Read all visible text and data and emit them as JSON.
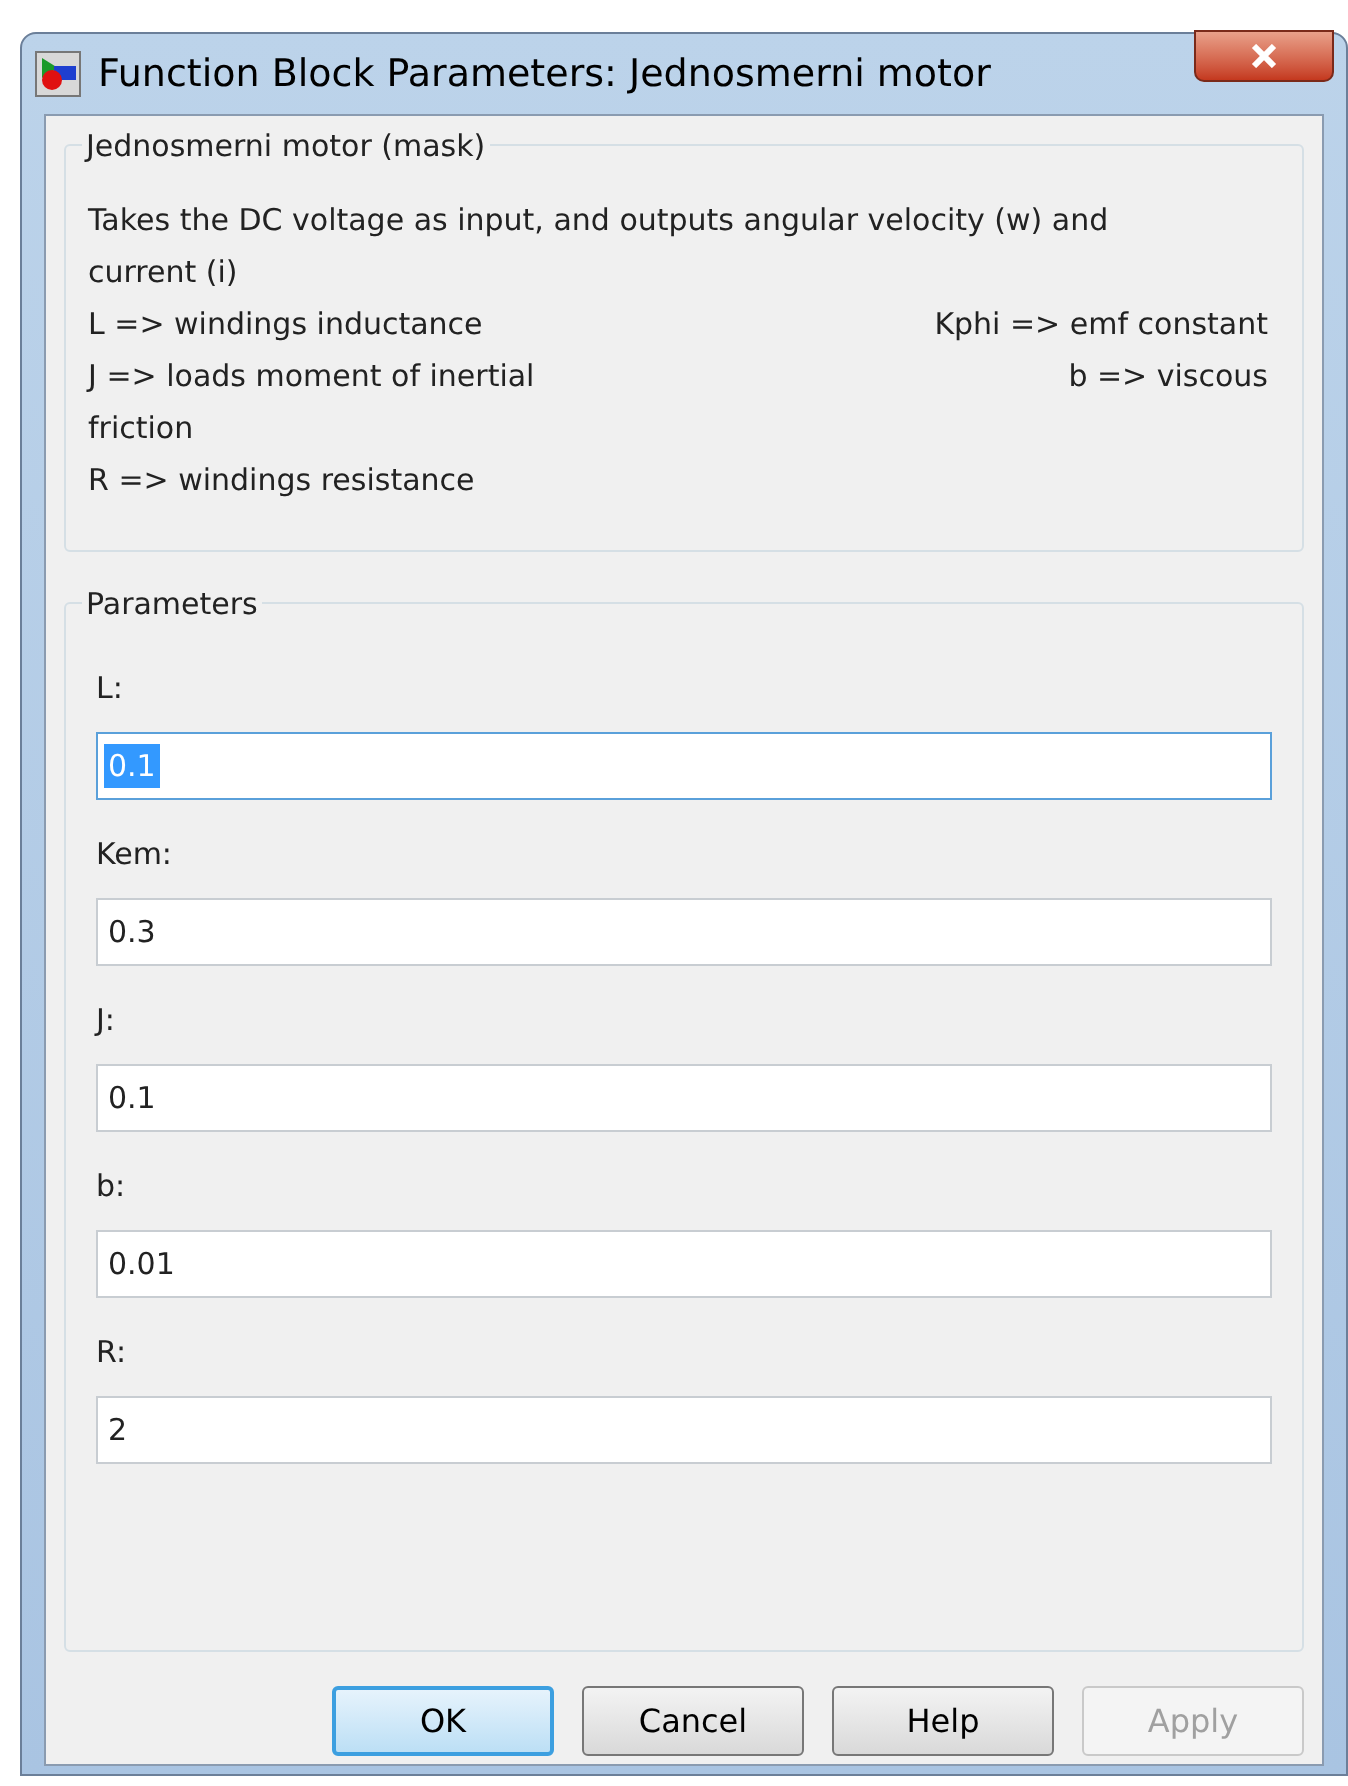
{
  "window": {
    "title": "Function Block Parameters: Jednosmerni motor"
  },
  "mask": {
    "title": "Jednosmerni motor (mask)",
    "lines": [
      {
        "parts": [
          "Takes the DC voltage as input, and outputs angular velocity (w) and"
        ]
      },
      {
        "parts": [
          "current (i)"
        ]
      },
      {
        "parts": [
          "L => windings inductance",
          "Kphi => emf constant"
        ]
      },
      {
        "parts": [
          "J => loads moment of inertial",
          "b => viscous"
        ]
      },
      {
        "parts": [
          "friction"
        ]
      },
      {
        "parts": [
          "R => windings resistance"
        ]
      }
    ]
  },
  "parameters": {
    "title": "Parameters",
    "fields": [
      {
        "label": "L:",
        "value": "0.1",
        "focused": true
      },
      {
        "label": "Kem:",
        "value": "0.3",
        "focused": false
      },
      {
        "label": "J:",
        "value": "0.1",
        "focused": false
      },
      {
        "label": "b:",
        "value": "0.01",
        "focused": false
      },
      {
        "label": "R:",
        "value": "2",
        "focused": false
      }
    ]
  },
  "buttons": [
    {
      "label": "OK",
      "default": true,
      "disabled": false
    },
    {
      "label": "Cancel",
      "default": false,
      "disabled": false
    },
    {
      "label": "Help",
      "default": false,
      "disabled": false
    },
    {
      "label": "Apply",
      "default": false,
      "disabled": true
    }
  ]
}
